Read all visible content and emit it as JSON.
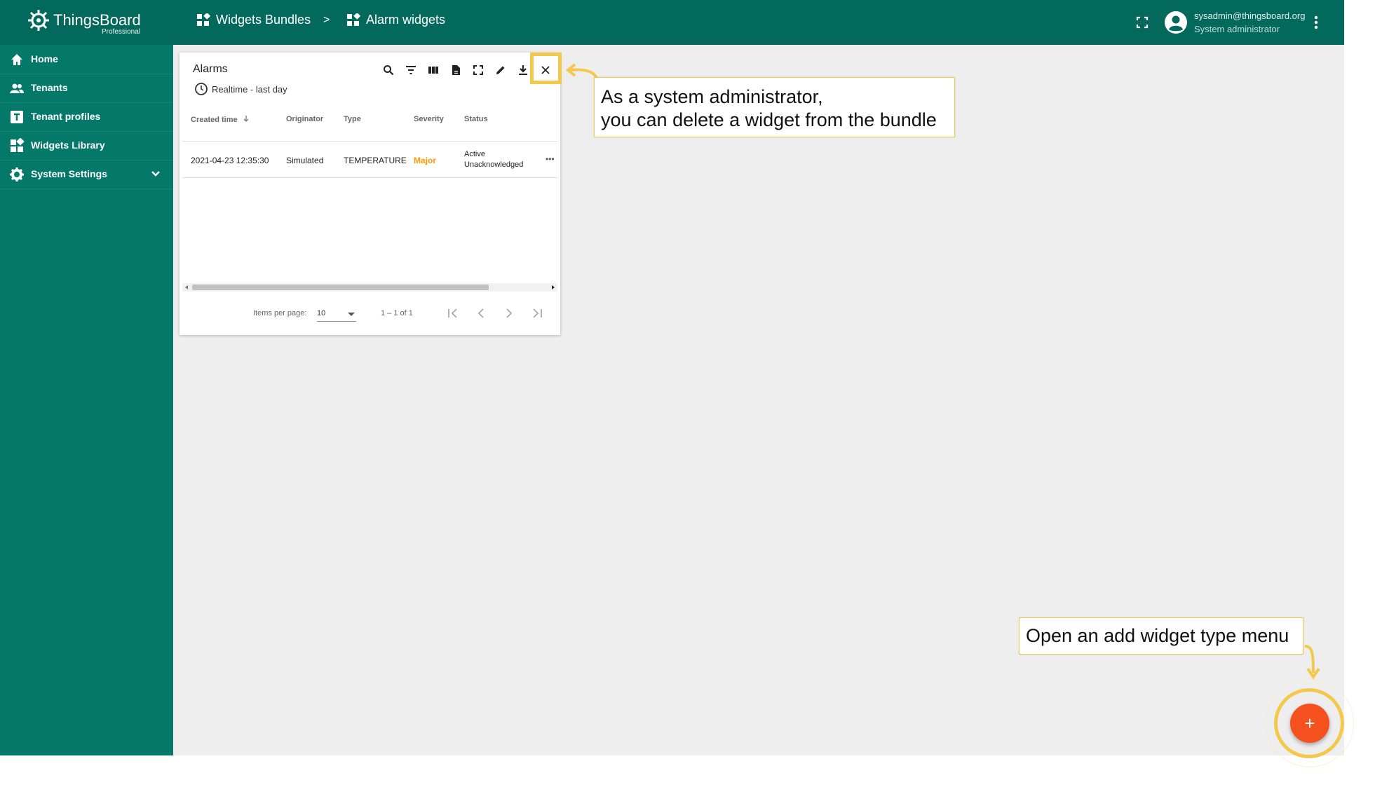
{
  "app": {
    "brand_name": "ThingsBoard",
    "brand_sub": "Professional"
  },
  "breadcrumb": [
    {
      "label": "Widgets Bundles",
      "icon": "widgets-icon"
    },
    {
      "label": "Alarm widgets",
      "icon": "widgets-icon"
    }
  ],
  "breadcrumb_sep": ">",
  "user": {
    "email": "sysadmin@thingsboard.org",
    "role": "System administrator"
  },
  "sidebar": {
    "items": [
      {
        "label": "Home",
        "icon": "home-icon"
      },
      {
        "label": "Tenants",
        "icon": "people-icon"
      },
      {
        "label": "Tenant profiles",
        "icon": "tenant-profile-icon"
      },
      {
        "label": "Widgets Library",
        "icon": "widgets-icon"
      },
      {
        "label": "System Settings",
        "icon": "gear-icon"
      }
    ]
  },
  "widget": {
    "title": "Alarms",
    "timewindow": "Realtime - last day",
    "columns": [
      "Created time",
      "Originator",
      "Type",
      "Severity",
      "Status"
    ],
    "rows": [
      {
        "created": "2021-04-23 12:35:30",
        "originator": "Simulated",
        "type": "TEMPERATURE",
        "severity": "Major",
        "status_line1": "Active",
        "status_line2": "Unacknowledged",
        "more": "•••"
      }
    ],
    "pagination": {
      "items_label": "Items per page:",
      "page_size": "10",
      "range": "1 – 1 of 1"
    }
  },
  "callouts": {
    "delete_line1": "As a system administrator,",
    "delete_line2": "you can delete a widget from the bundle",
    "add_menu": "Open an add widget type menu"
  },
  "fab": {
    "label": "+"
  },
  "colors": {
    "primary": "#03695c",
    "sidebar": "#04796a",
    "accent": "#f4511e",
    "highlight": "#f2c94c",
    "major": "#ff9800"
  }
}
